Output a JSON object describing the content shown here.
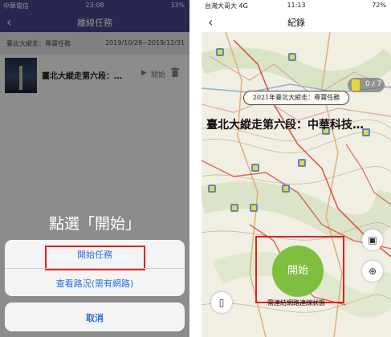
{
  "left_screen": {
    "status": {
      "carrier": "中華電信 ",
      "time": "23:08",
      "battery": "33%"
    },
    "nav": {
      "back_icon": "‹",
      "title": "離線任務"
    },
    "mission_header": {
      "name": "臺北大縱走：尋寶任務",
      "date_range": "2019/10/28~2019/12/31"
    },
    "mission_row": {
      "title": "臺北大縱走第六段：…",
      "play_icon": "▶",
      "start_label": "開始"
    },
    "hint": "點選「開始」",
    "sheet": {
      "start_task": "開始任務",
      "view_route": "查看路況(需有網路)",
      "cancel": "取消"
    },
    "colors": {
      "nav": "#4c4891",
      "accent_text": "#2a6fd6",
      "highlight": "#e02020"
    }
  },
  "right_screen": {
    "status": {
      "carrier": "台灣大哥大 4G",
      "time": "11:13",
      "battery": "72%"
    },
    "nav": {
      "back_icon": "‹",
      "title": "紀錄"
    },
    "counter": "0 / 7",
    "badge": "2021年臺北大縱走：尋寶任務",
    "title": "臺北大縱走第六段：中華科技…",
    "start_button": "開始",
    "warning": "需連結網路連線狀態",
    "buttons": {
      "photo_icon": "▣",
      "locate_icon": "⊕",
      "layers_icon": "▯"
    },
    "colors": {
      "start": "#7fbf3f",
      "highlight": "#e02020",
      "route": "#d9342b"
    }
  }
}
